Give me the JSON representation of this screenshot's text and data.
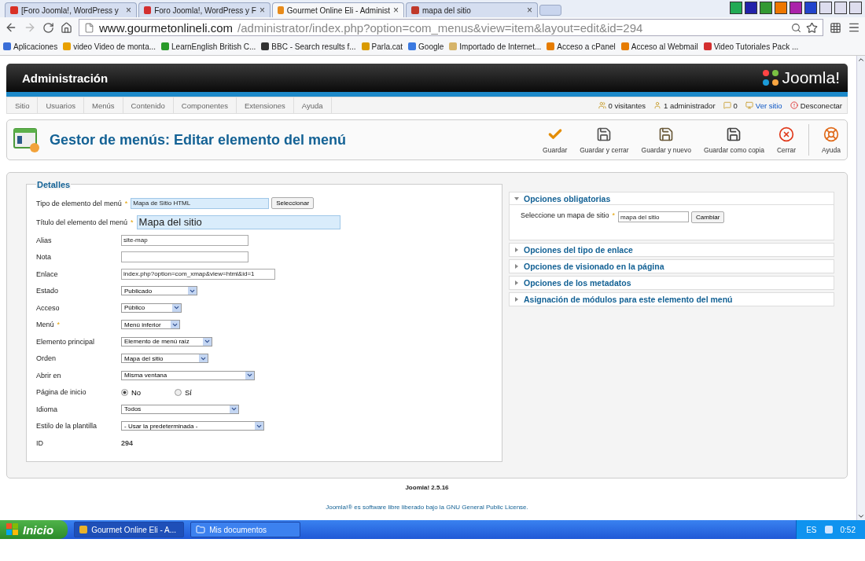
{
  "browser": {
    "tabs": [
      {
        "title": "[Foro Joomla!, WordPress y",
        "selected": false,
        "close": "×"
      },
      {
        "title": "Foro Joomla!, WordPress y F",
        "selected": false,
        "close": "×"
      },
      {
        "title": "Gourmet Online Eli - Administ",
        "selected": true,
        "close": "×"
      },
      {
        "title": "mapa del sitio",
        "selected": false,
        "close": "×"
      }
    ],
    "url_host": "www.gourmetonlineli.com",
    "url_path": "/administrator/index.php?option=com_menus&view=item&layout=edit&id=294",
    "bookmarks": [
      "Aplicaciones",
      "video Video de monta...",
      "LearnEnglish  British C...",
      "BBC - Search results f...",
      "Parla.cat",
      "Google",
      "Importado de Internet...",
      "Acceso a cPanel",
      "Acceso al Webmail",
      "Video Tutoriales Pack ..."
    ]
  },
  "header": {
    "title": "Administración",
    "logo": "Joomla!"
  },
  "nav": {
    "menus": [
      "Sitio",
      "Usuarios",
      "Menús",
      "Contenido",
      "Componentes",
      "Extensiones",
      "Ayuda"
    ],
    "status": [
      "0 visitantes",
      "1 administrador",
      "0",
      "Ver sitio",
      "Desconectar"
    ]
  },
  "toolbar": {
    "title": "Gestor de menús: Editar elemento del menú",
    "buttons": [
      "Guardar",
      "Guardar y cerrar",
      "Guardar y nuevo",
      "Guardar como copia",
      "Cerrar",
      "Ayuda"
    ]
  },
  "details": {
    "legend": "Detalles",
    "required_symbol": "*",
    "fields": [
      {
        "label": "Tipo de elemento del menú",
        "required": true,
        "kind": "text",
        "value": "Mapa de Sitio HTML",
        "highlighted": true,
        "button": "Seleccionar"
      },
      {
        "label": "Título del elemento del menú",
        "required": true,
        "kind": "text",
        "value": "Mapa del sitio",
        "highlighted": true
      },
      {
        "label": "Alias",
        "required": false,
        "kind": "text",
        "value": "site-map",
        "highlighted": false
      },
      {
        "label": "Nota",
        "required": false,
        "kind": "text",
        "highlighted": false
      },
      {
        "label": "Enlace",
        "required": false,
        "kind": "text",
        "value": "index.php?option=com_xmap&view=html&id=1",
        "highlighted": false
      },
      {
        "label": "Estado",
        "required": false,
        "kind": "select",
        "value": "Publicado"
      },
      {
        "label": "Acceso",
        "required": false,
        "kind": "select",
        "value": "Público"
      },
      {
        "label": "Menú",
        "required": true,
        "kind": "select",
        "value": "Menú inferior"
      },
      {
        "label": "Elemento principal",
        "required": false,
        "kind": "select",
        "value": "Elemento de menú raíz"
      },
      {
        "label": "Orden",
        "required": false,
        "kind": "select",
        "value": "Mapa del sitio"
      },
      {
        "label": "Abrir en",
        "required": false,
        "kind": "select",
        "value": "Misma ventana"
      },
      {
        "label": "Página de inicio",
        "required": false,
        "kind": "radio",
        "options": [
          {
            "label": "No",
            "selected": true
          },
          {
            "label": "Sí",
            "selected": false
          }
        ]
      },
      {
        "label": "Idioma",
        "required": false,
        "kind": "select",
        "value": "Todos"
      },
      {
        "label": "Estilo de la plantilla",
        "required": false,
        "kind": "select",
        "value": "- Usar la predeterminada -"
      },
      {
        "label": "ID",
        "required": false,
        "kind": "static",
        "value": "294"
      }
    ]
  },
  "panels": [
    {
      "title": "Opciones obligatorias",
      "expanded": true,
      "field": {
        "label": "Seleccione un mapa de sitio",
        "required": true,
        "required_symbol": "*",
        "value": "mapa del sitio",
        "button": "Cambiar"
      }
    },
    {
      "title": "Opciones del tipo de enlace",
      "expanded": false
    },
    {
      "title": "Opciones de visionado en la página",
      "expanded": false
    },
    {
      "title": "Opciones de los metadatos",
      "expanded": false
    },
    {
      "title": "Asignación de módulos para este elemento del menú",
      "expanded": false
    }
  ],
  "footer": {
    "version": "Joomla! 2.5.16",
    "license": "Joomla!® es software libre liberado bajo la",
    "license_link": "GNU General Public License",
    "license_end": "."
  },
  "taskbar": {
    "start": "Inicio",
    "items": [
      "Gourmet Online Eli - A...",
      "Mis documentos"
    ],
    "lang": "ES",
    "time": "0:52"
  }
}
